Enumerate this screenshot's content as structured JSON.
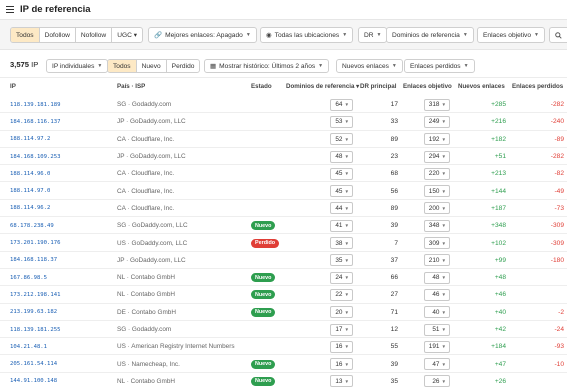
{
  "header": {
    "title": "IP de referencia"
  },
  "filters": {
    "link_type": [
      "Todos",
      "Dofollow",
      "Nofollow",
      "UGC ▾"
    ],
    "best_links": "Mejores enlaces: Apagado",
    "locations": "Todas las ubicaciones",
    "dr": "DR",
    "ref_domains": "Dominios de referencia",
    "target_links": "Enlaces objetivo",
    "search_icon": "search-icon"
  },
  "toolbar": {
    "count_value": "3,575",
    "count_unit": "IP",
    "ip_mode": "IP individuales",
    "status_tabs": [
      "Todos",
      "Nuevo",
      "Perdido"
    ],
    "history": "Mostrar histórico: Últimos 2 años",
    "new_links": "Nuevos enlaces",
    "lost_links": "Enlaces perdidos"
  },
  "table": {
    "columns": {
      "ip": "IP",
      "country_isp": "País · ISP",
      "status": "Estado",
      "ref_domains": "Dominios de referencia ▾",
      "dr": "DR principal",
      "target_links": "Enlaces objetivo",
      "new_links": "Nuevos enlaces",
      "lost_links": "Enlaces perdidos"
    },
    "rows": [
      {
        "ip": "118.139.181.189",
        "isp": "SG · Godaddy.com",
        "status": "",
        "domains": "64",
        "dr": "17",
        "target": "318",
        "new": "+285",
        "lost": "-282"
      },
      {
        "ip": "184.168.116.137",
        "isp": "JP · GoDaddy.com, LLC",
        "status": "",
        "domains": "53",
        "dr": "33",
        "target": "249",
        "new": "+216",
        "lost": "-240"
      },
      {
        "ip": "188.114.97.2",
        "isp": "CA · Cloudflare, Inc.",
        "status": "",
        "domains": "52",
        "dr": "89",
        "target": "192",
        "new": "+182",
        "lost": "-89"
      },
      {
        "ip": "184.168.109.253",
        "isp": "JP · GoDaddy.com, LLC",
        "status": "",
        "domains": "48",
        "dr": "23",
        "target": "294",
        "new": "+51",
        "lost": "-282"
      },
      {
        "ip": "188.114.96.0",
        "isp": "CA · Cloudflare, Inc.",
        "status": "",
        "domains": "45",
        "dr": "68",
        "target": "220",
        "new": "+213",
        "lost": "-82"
      },
      {
        "ip": "188.114.97.0",
        "isp": "CA · Cloudflare, Inc.",
        "status": "",
        "domains": "45",
        "dr": "56",
        "target": "150",
        "new": "+144",
        "lost": "-49"
      },
      {
        "ip": "188.114.96.2",
        "isp": "CA · Cloudflare, Inc.",
        "status": "",
        "domains": "44",
        "dr": "89",
        "target": "200",
        "new": "+187",
        "lost": "-73"
      },
      {
        "ip": "68.178.238.49",
        "isp": "SG · GoDaddy.com, LLC",
        "status": "Nuevo",
        "domains": "41",
        "dr": "39",
        "target": "348",
        "new": "+348",
        "lost": "-309"
      },
      {
        "ip": "173.201.190.176",
        "isp": "US · GoDaddy.com, LLC",
        "status": "Perdido",
        "domains": "38",
        "dr": "7",
        "target": "309",
        "new": "+102",
        "lost": "-309"
      },
      {
        "ip": "184.168.118.37",
        "isp": "JP · GoDaddy.com, LLC",
        "status": "",
        "domains": "35",
        "dr": "37",
        "target": "210",
        "new": "+99",
        "lost": "-180"
      },
      {
        "ip": "167.86.98.5",
        "isp": "NL · Contabo GmbH",
        "status": "Nuevo",
        "domains": "24",
        "dr": "66",
        "target": "48",
        "new": "+48",
        "lost": ""
      },
      {
        "ip": "173.212.198.141",
        "isp": "NL · Contabo GmbH",
        "status": "Nuevo",
        "domains": "22",
        "dr": "27",
        "target": "46",
        "new": "+46",
        "lost": ""
      },
      {
        "ip": "213.199.63.182",
        "isp": "DE · Contabo GmbH",
        "status": "Nuevo",
        "domains": "20",
        "dr": "71",
        "target": "40",
        "new": "+40",
        "lost": "-2"
      },
      {
        "ip": "118.139.181.255",
        "isp": "SG · Godaddy.com",
        "status": "",
        "domains": "17",
        "dr": "12",
        "target": "51",
        "new": "+42",
        "lost": "-24"
      },
      {
        "ip": "104.21.48.1",
        "isp": "US · American Registry Internet Numbers",
        "status": "",
        "domains": "16",
        "dr": "55",
        "target": "191",
        "new": "+184",
        "lost": "-93"
      },
      {
        "ip": "205.161.54.114",
        "isp": "US · Namecheap, Inc.",
        "status": "Nuevo",
        "domains": "16",
        "dr": "39",
        "target": "47",
        "new": "+47",
        "lost": "-10"
      },
      {
        "ip": "144.91.100.148",
        "isp": "NL · Contabo GmbH",
        "status": "Nuevo",
        "domains": "13",
        "dr": "35",
        "target": "26",
        "new": "+26",
        "lost": ""
      }
    ]
  }
}
